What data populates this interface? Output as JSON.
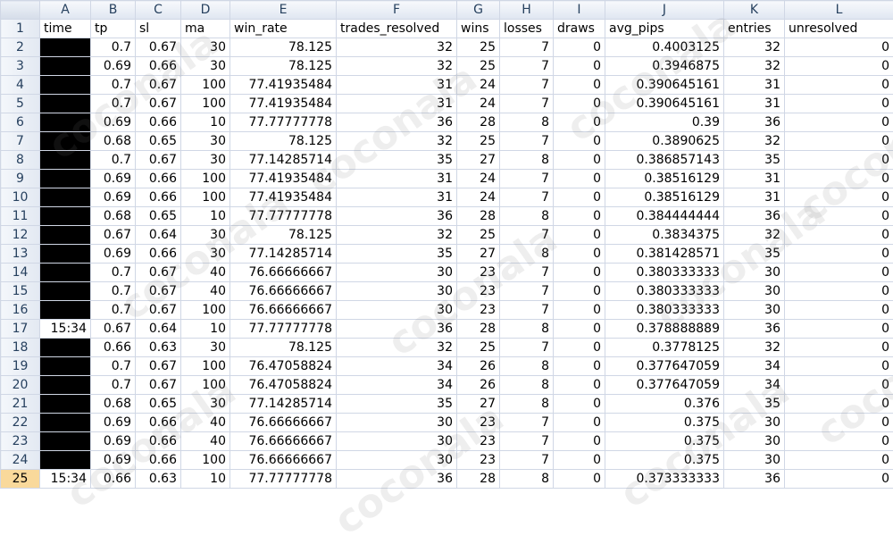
{
  "columns": [
    "A",
    "B",
    "C",
    "D",
    "E",
    "F",
    "G",
    "H",
    "I",
    "J",
    "K",
    "L"
  ],
  "active_row": "25",
  "header_row": {
    "row": "1",
    "cells": [
      "time",
      "tp",
      "sl",
      "ma",
      "win_rate",
      "trades_resolved",
      "wins",
      "losses",
      "draws",
      "avg_pips",
      "entries",
      "unresolved"
    ]
  },
  "rows": [
    {
      "row": "2",
      "time": "",
      "tp": "0.7",
      "sl": "0.67",
      "ma": "30",
      "win_rate": "78.125",
      "trades_resolved": "32",
      "wins": "25",
      "losses": "7",
      "draws": "0",
      "avg_pips": "0.4003125",
      "entries": "32",
      "unresolved": "0"
    },
    {
      "row": "3",
      "time": "",
      "tp": "0.69",
      "sl": "0.66",
      "ma": "30",
      "win_rate": "78.125",
      "trades_resolved": "32",
      "wins": "25",
      "losses": "7",
      "draws": "0",
      "avg_pips": "0.3946875",
      "entries": "32",
      "unresolved": "0"
    },
    {
      "row": "4",
      "time": "",
      "tp": "0.7",
      "sl": "0.67",
      "ma": "100",
      "win_rate": "77.41935484",
      "trades_resolved": "31",
      "wins": "24",
      "losses": "7",
      "draws": "0",
      "avg_pips": "0.390645161",
      "entries": "31",
      "unresolved": "0"
    },
    {
      "row": "5",
      "time": "",
      "tp": "0.7",
      "sl": "0.67",
      "ma": "100",
      "win_rate": "77.41935484",
      "trades_resolved": "31",
      "wins": "24",
      "losses": "7",
      "draws": "0",
      "avg_pips": "0.390645161",
      "entries": "31",
      "unresolved": "0"
    },
    {
      "row": "6",
      "time": "",
      "tp": "0.69",
      "sl": "0.66",
      "ma": "10",
      "win_rate": "77.77777778",
      "trades_resolved": "36",
      "wins": "28",
      "losses": "8",
      "draws": "0",
      "avg_pips": "0.39",
      "entries": "36",
      "unresolved": "0"
    },
    {
      "row": "7",
      "time": "",
      "tp": "0.68",
      "sl": "0.65",
      "ma": "30",
      "win_rate": "78.125",
      "trades_resolved": "32",
      "wins": "25",
      "losses": "7",
      "draws": "0",
      "avg_pips": "0.3890625",
      "entries": "32",
      "unresolved": "0"
    },
    {
      "row": "8",
      "time": "",
      "tp": "0.7",
      "sl": "0.67",
      "ma": "30",
      "win_rate": "77.14285714",
      "trades_resolved": "35",
      "wins": "27",
      "losses": "8",
      "draws": "0",
      "avg_pips": "0.386857143",
      "entries": "35",
      "unresolved": "0"
    },
    {
      "row": "9",
      "time": "",
      "tp": "0.69",
      "sl": "0.66",
      "ma": "100",
      "win_rate": "77.41935484",
      "trades_resolved": "31",
      "wins": "24",
      "losses": "7",
      "draws": "0",
      "avg_pips": "0.38516129",
      "entries": "31",
      "unresolved": "0"
    },
    {
      "row": "10",
      "time": "",
      "tp": "0.69",
      "sl": "0.66",
      "ma": "100",
      "win_rate": "77.41935484",
      "trades_resolved": "31",
      "wins": "24",
      "losses": "7",
      "draws": "0",
      "avg_pips": "0.38516129",
      "entries": "31",
      "unresolved": "0"
    },
    {
      "row": "11",
      "time": "",
      "tp": "0.68",
      "sl": "0.65",
      "ma": "10",
      "win_rate": "77.77777778",
      "trades_resolved": "36",
      "wins": "28",
      "losses": "8",
      "draws": "0",
      "avg_pips": "0.384444444",
      "entries": "36",
      "unresolved": "0"
    },
    {
      "row": "12",
      "time": "",
      "tp": "0.67",
      "sl": "0.64",
      "ma": "30",
      "win_rate": "78.125",
      "trades_resolved": "32",
      "wins": "25",
      "losses": "7",
      "draws": "0",
      "avg_pips": "0.3834375",
      "entries": "32",
      "unresolved": "0"
    },
    {
      "row": "13",
      "time": "",
      "tp": "0.69",
      "sl": "0.66",
      "ma": "30",
      "win_rate": "77.14285714",
      "trades_resolved": "35",
      "wins": "27",
      "losses": "8",
      "draws": "0",
      "avg_pips": "0.381428571",
      "entries": "35",
      "unresolved": "0"
    },
    {
      "row": "14",
      "time": "",
      "tp": "0.7",
      "sl": "0.67",
      "ma": "40",
      "win_rate": "76.66666667",
      "trades_resolved": "30",
      "wins": "23",
      "losses": "7",
      "draws": "0",
      "avg_pips": "0.380333333",
      "entries": "30",
      "unresolved": "0"
    },
    {
      "row": "15",
      "time": "",
      "tp": "0.7",
      "sl": "0.67",
      "ma": "40",
      "win_rate": "76.66666667",
      "trades_resolved": "30",
      "wins": "23",
      "losses": "7",
      "draws": "0",
      "avg_pips": "0.380333333",
      "entries": "30",
      "unresolved": "0"
    },
    {
      "row": "16",
      "time": "",
      "tp": "0.7",
      "sl": "0.67",
      "ma": "100",
      "win_rate": "76.66666667",
      "trades_resolved": "30",
      "wins": "23",
      "losses": "7",
      "draws": "0",
      "avg_pips": "0.380333333",
      "entries": "30",
      "unresolved": "0"
    },
    {
      "row": "17",
      "time": "15:34",
      "tp": "0.67",
      "sl": "0.64",
      "ma": "10",
      "win_rate": "77.77777778",
      "trades_resolved": "36",
      "wins": "28",
      "losses": "8",
      "draws": "0",
      "avg_pips": "0.378888889",
      "entries": "36",
      "unresolved": "0"
    },
    {
      "row": "18",
      "time": "",
      "tp": "0.66",
      "sl": "0.63",
      "ma": "30",
      "win_rate": "78.125",
      "trades_resolved": "32",
      "wins": "25",
      "losses": "7",
      "draws": "0",
      "avg_pips": "0.3778125",
      "entries": "32",
      "unresolved": "0"
    },
    {
      "row": "19",
      "time": "",
      "tp": "0.7",
      "sl": "0.67",
      "ma": "100",
      "win_rate": "76.47058824",
      "trades_resolved": "34",
      "wins": "26",
      "losses": "8",
      "draws": "0",
      "avg_pips": "0.377647059",
      "entries": "34",
      "unresolved": "0"
    },
    {
      "row": "20",
      "time": "",
      "tp": "0.7",
      "sl": "0.67",
      "ma": "100",
      "win_rate": "76.47058824",
      "trades_resolved": "34",
      "wins": "26",
      "losses": "8",
      "draws": "0",
      "avg_pips": "0.377647059",
      "entries": "34",
      "unresolved": "0"
    },
    {
      "row": "21",
      "time": "",
      "tp": "0.68",
      "sl": "0.65",
      "ma": "30",
      "win_rate": "77.14285714",
      "trades_resolved": "35",
      "wins": "27",
      "losses": "8",
      "draws": "0",
      "avg_pips": "0.376",
      "entries": "35",
      "unresolved": "0"
    },
    {
      "row": "22",
      "time": "",
      "tp": "0.69",
      "sl": "0.66",
      "ma": "40",
      "win_rate": "76.66666667",
      "trades_resolved": "30",
      "wins": "23",
      "losses": "7",
      "draws": "0",
      "avg_pips": "0.375",
      "entries": "30",
      "unresolved": "0"
    },
    {
      "row": "23",
      "time": "",
      "tp": "0.69",
      "sl": "0.66",
      "ma": "40",
      "win_rate": "76.66666667",
      "trades_resolved": "30",
      "wins": "23",
      "losses": "7",
      "draws": "0",
      "avg_pips": "0.375",
      "entries": "30",
      "unresolved": "0"
    },
    {
      "row": "24",
      "time": "",
      "tp": "0.69",
      "sl": "0.66",
      "ma": "100",
      "win_rate": "76.66666667",
      "trades_resolved": "30",
      "wins": "23",
      "losses": "7",
      "draws": "0",
      "avg_pips": "0.375",
      "entries": "30",
      "unresolved": "0"
    },
    {
      "row": "25",
      "time": "15:34",
      "tp": "0.66",
      "sl": "0.63",
      "ma": "10",
      "win_rate": "77.77777778",
      "trades_resolved": "36",
      "wins": "28",
      "losses": "8",
      "draws": "0",
      "avg_pips": "0.373333333",
      "entries": "36",
      "unresolved": "0"
    }
  ],
  "watermark": "coconala",
  "colors": {
    "redaction": "#000000",
    "active_row_header": "#f9d99b",
    "gridline": "#d0d7e5"
  }
}
